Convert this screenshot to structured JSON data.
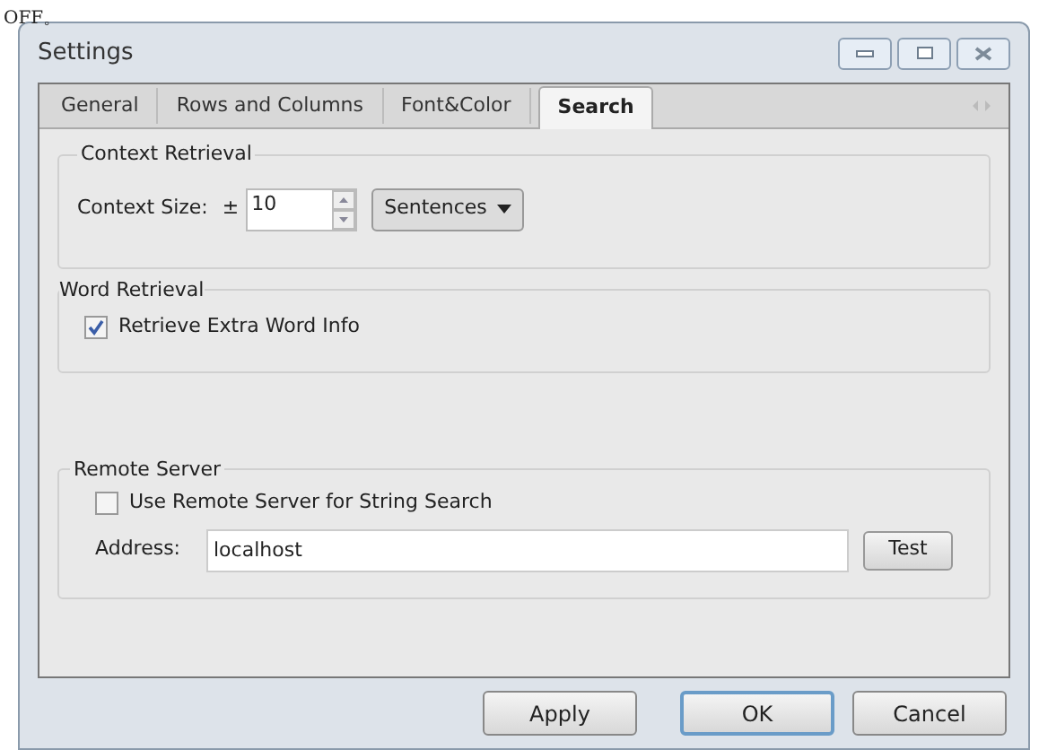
{
  "backdrop_text": "OFF。",
  "window": {
    "title": "Settings"
  },
  "tabs": [
    {
      "label": "General",
      "selected": false
    },
    {
      "label": "Rows and Columns",
      "selected": false
    },
    {
      "label": "Font&Color",
      "selected": false
    },
    {
      "label": "Search",
      "selected": true
    }
  ],
  "context_retrieval": {
    "title": "Context Retrieval",
    "label": "Context Size:",
    "prefix": "±",
    "value": "10",
    "unit": "Sentences"
  },
  "word_retrieval": {
    "title": "Word Retrieval",
    "checkbox": {
      "label": "Retrieve Extra Word Info",
      "checked": true
    }
  },
  "remote_server": {
    "title": "Remote Server",
    "checkbox": {
      "label": "Use Remote Server for String Search",
      "checked": false
    },
    "address_label": "Address:",
    "address": "localhost",
    "test_button": "Test"
  },
  "buttons": [
    {
      "label": "Apply",
      "default": false
    },
    {
      "label": "OK",
      "default": true
    },
    {
      "label": "Cancel",
      "default": false
    }
  ]
}
